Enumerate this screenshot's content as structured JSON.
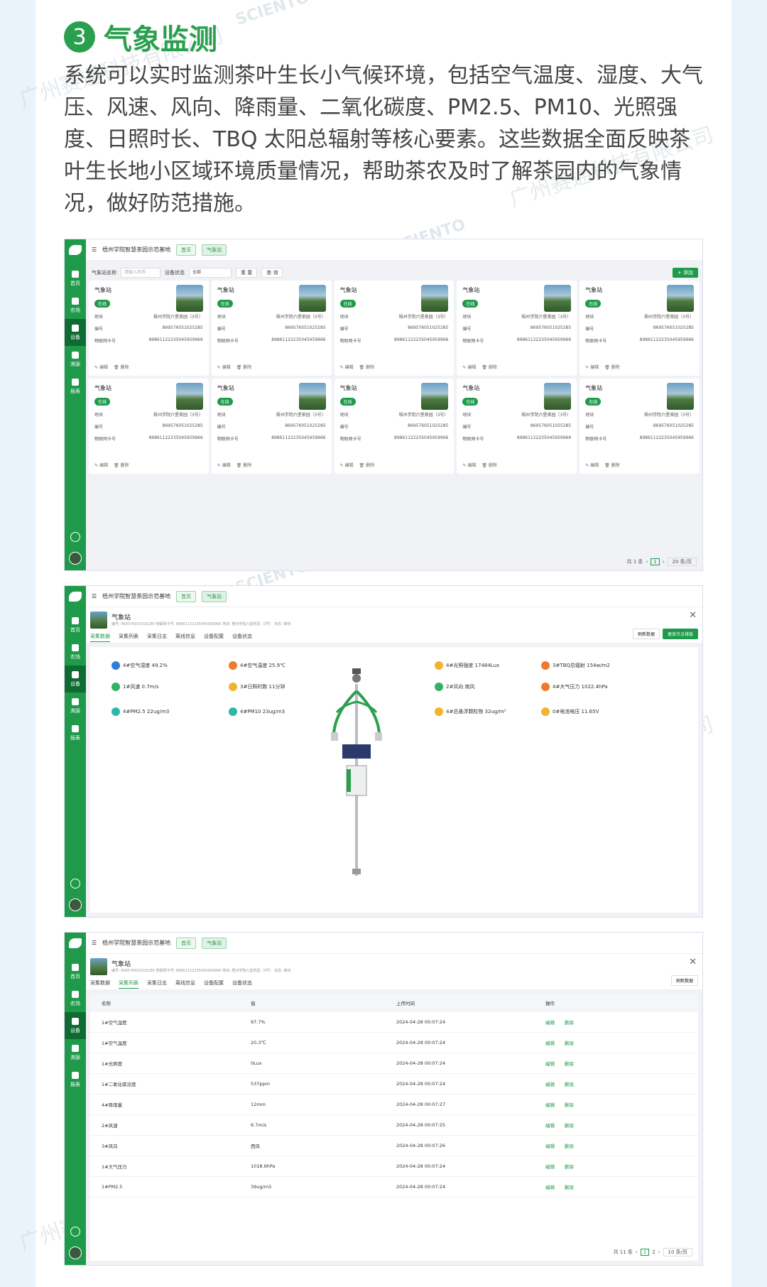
{
  "section": {
    "number": "3",
    "title": "气象监测"
  },
  "intro": "系统可以实时监测茶叶生长小气候环境，包括空气温度、湿度、大气压、风速、风向、降雨量、二氧化碳度、PM2.5、PM10、光照强度、日照时长、TBQ 太阳总辐射等核心要素。这些数据全面反映茶叶生长地小区域环境质量情况，帮助茶农及时了解茶园内的气象情况，做好防范措施。",
  "watermarks": {
    "company": "广州赛通科技有限公司",
    "brand_en": "SCIENTO",
    "brand_cn": "赛通科技"
  },
  "app": {
    "base_name": "梧州学院智慧茶园示范基地",
    "tab_home": "首页",
    "tab_station": "气象站",
    "sidebar": [
      "首页",
      "农场",
      "设备",
      "溯源",
      "报表"
    ]
  },
  "list_page": {
    "filter_label": "气象站名称",
    "filter_placeholder": "请输入名称",
    "status_label": "设备状态",
    "status_value": "全部",
    "reset": "重 置",
    "query": "查 询",
    "add": "+ 添加",
    "card": {
      "name": "气象站",
      "status": "在线",
      "plot_label": "地块",
      "plot_value": "梧州学院六堡茶园（3号）",
      "code_label": "编号",
      "code_value": "869576051025285",
      "sim_label": "物联网卡号",
      "sim_value": "89861122235045959966",
      "edit": "编辑",
      "delete": "删除"
    },
    "card_count": 10,
    "pager": {
      "total": "共 1 条",
      "page": "1",
      "size": "20 条/页"
    }
  },
  "detail": {
    "name": "气象站",
    "meta": "编号: 869576051025285    物联网卡号: 89861122235045959966    地块: 梧州学院六堡茶园（3号）    状态: 离线",
    "tabs": [
      "采集数据",
      "采集列表",
      "采集日志",
      "离线信息",
      "设备配置",
      "设备状态"
    ],
    "refresh": "刷新数据",
    "change_node": "更改节点排版",
    "sensors_left": [
      {
        "label": "4#空气湿度 49.2%",
        "color": "#2e7fd9"
      },
      {
        "label": "1#风速 0.7m/s",
        "color": "#35b067"
      },
      {
        "label": "4#PM2.5 22ug/m3",
        "color": "#2cb8a8"
      }
    ],
    "sensors_mid": [
      {
        "label": "4#空气温度 25.9℃",
        "color": "#f07a2c"
      },
      {
        "label": "3#日照时数 11分钟",
        "color": "#f0b52c"
      },
      {
        "label": "4#PM10 23ug/m3",
        "color": "#2cb8a8"
      }
    ],
    "sensors_r1": [
      {
        "label": "4#光照强度 17484Lux",
        "color": "#f0b52c"
      },
      {
        "label": "2#风向 南风",
        "color": "#35b067"
      },
      {
        "label": "4#总悬浮颗粒物 32ug/m³",
        "color": "#f0b52c"
      }
    ],
    "sensors_r2": [
      {
        "label": "3#TBQ总辐射 154w/m2",
        "color": "#f07a2c"
      },
      {
        "label": "4#大气压力 1022.4hPa",
        "color": "#f07a2c"
      },
      {
        "label": "0#电池电压 11.65V",
        "color": "#f0b52c"
      }
    ]
  },
  "table": {
    "headers": [
      "名称",
      "值",
      "上传时间",
      "操作"
    ],
    "rows": [
      [
        "1#空气湿度",
        "97.7%",
        "2024-04-28 00:07:24"
      ],
      [
        "1#空气温度",
        "20.3℃",
        "2024-04-28 00:07:24"
      ],
      [
        "1#光照度",
        "0Lux",
        "2024-04-28 00:07:24"
      ],
      [
        "1#二氧化碳浓度",
        "537ppm",
        "2024-04-28 00:07:24"
      ],
      [
        "4#降雨量",
        "12mm",
        "2024-04-28 00:07:27"
      ],
      [
        "2#风速",
        "6.7m/s",
        "2024-04-28 00:07:25"
      ],
      [
        "3#风向",
        "西风",
        "2024-04-28 00:07:26"
      ],
      [
        "1#大气压力",
        "1018.6hPa",
        "2024-04-28 00:07:24"
      ],
      [
        "1#PM2.5",
        "39ug/m3",
        "2024-04-28 00:07:24"
      ]
    ],
    "edit": "编辑",
    "delete": "删除",
    "pager": {
      "total": "共 11 条",
      "p1": "1",
      "p2": "2",
      "size": "10 条/页"
    }
  }
}
